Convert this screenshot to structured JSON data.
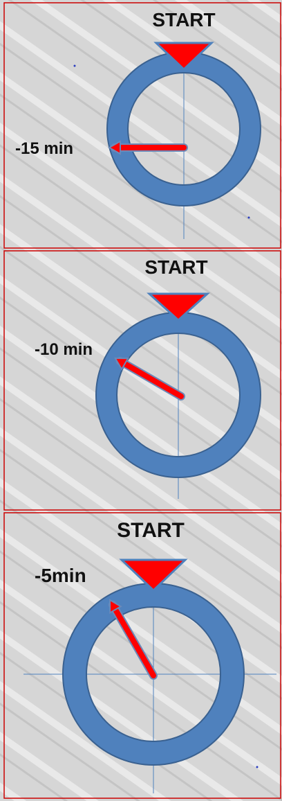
{
  "panels": [
    {
      "start_label": "START",
      "time_label": "-15 min",
      "hand_angle_deg": 270
    },
    {
      "start_label": "START",
      "time_label": "-10 min",
      "hand_angle_deg": 300
    },
    {
      "start_label": "START",
      "time_label": "-5min",
      "hand_angle_deg": 330
    }
  ],
  "colors": {
    "ring": "#4f81bd",
    "ring_stroke": "#3a6190",
    "hand": "#ff0000",
    "hand_stroke": "#6c89b8",
    "marker": "#ff0000",
    "panel_border": "#cc0000",
    "crosshair": "#4f81bd",
    "text": "#111111"
  }
}
